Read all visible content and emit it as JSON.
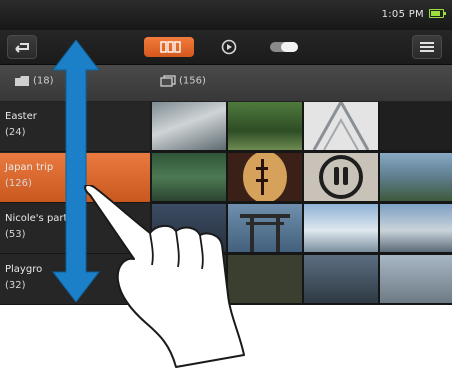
{
  "status_bar": {
    "time": "1:05 PM",
    "battery_color": "#9be03c"
  },
  "toolbar": {
    "back_icon": "back-arrow-icon",
    "tabs": [
      {
        "name": "photos",
        "icon": "photos-icon",
        "active": true
      },
      {
        "name": "video",
        "icon": "play-circle-icon",
        "active": false
      },
      {
        "name": "toggle",
        "icon": "toggle-icon",
        "active": false
      }
    ],
    "menu_icon": "menu-lines-icon",
    "accent_color": "#e66c2c"
  },
  "sort_bar": {
    "items": [
      {
        "icon": "folder-icon",
        "label": "(18)"
      },
      {
        "icon": "photo-stack-icon",
        "label": "(156)"
      }
    ]
  },
  "folders": [
    {
      "name": "Easter",
      "count": "(24)",
      "active": false
    },
    {
      "name": "Japan trip",
      "count": "(126)",
      "active": true
    },
    {
      "name": "Nicole's party",
      "count": "(53)",
      "active": false
    },
    {
      "name": "Playgro",
      "count": "(32)",
      "active": false
    }
  ],
  "gestures": {
    "drag_arrow": "double-arrow-vertical-icon",
    "hand": "pointing-hand-icon",
    "arrow_color": "#1b80c8"
  }
}
